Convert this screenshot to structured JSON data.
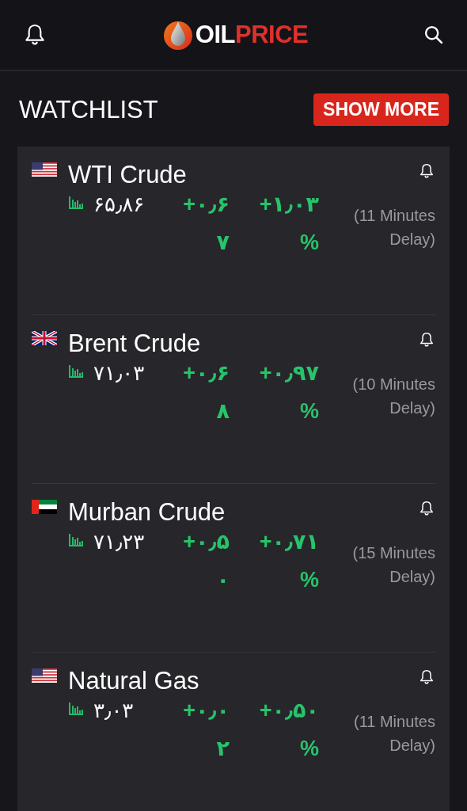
{
  "header": {
    "logo_start": "OIL",
    "logo_end": "PRICE"
  },
  "watchlist": {
    "title": "WATCHLIST",
    "button": "SHOW MORE"
  },
  "items": [
    {
      "kind": "us",
      "name": "WTI Crude",
      "price": "۶۵٫۸۶",
      "change": [
        "+۰٫۶",
        "۷"
      ],
      "percent": [
        "+۱٫۰۳",
        "%"
      ],
      "delay": "(11 Minutes Delay)"
    },
    {
      "kind": "uk",
      "name": "Brent Crude",
      "price": "۷۱٫۰۳",
      "change": [
        "+۰٫۶",
        "۸"
      ],
      "percent": [
        "+۰٫۹۷",
        "%"
      ],
      "delay": "(10 Minutes Delay)"
    },
    {
      "kind": "uae",
      "name": "Murban Crude",
      "price": "۷۱٫۲۳",
      "change": [
        "+۰٫۵",
        "۰"
      ],
      "percent": [
        "+۰٫۷۱",
        "%"
      ],
      "delay": "(15 Minutes Delay)"
    },
    {
      "kind": "us",
      "name": "Natural Gas",
      "price": "۳٫۰۳",
      "change": [
        "+۰٫۰",
        "۲"
      ],
      "percent": [
        "+۰٫۵۰",
        "%"
      ],
      "delay": "(11 Minutes Delay)"
    }
  ]
}
